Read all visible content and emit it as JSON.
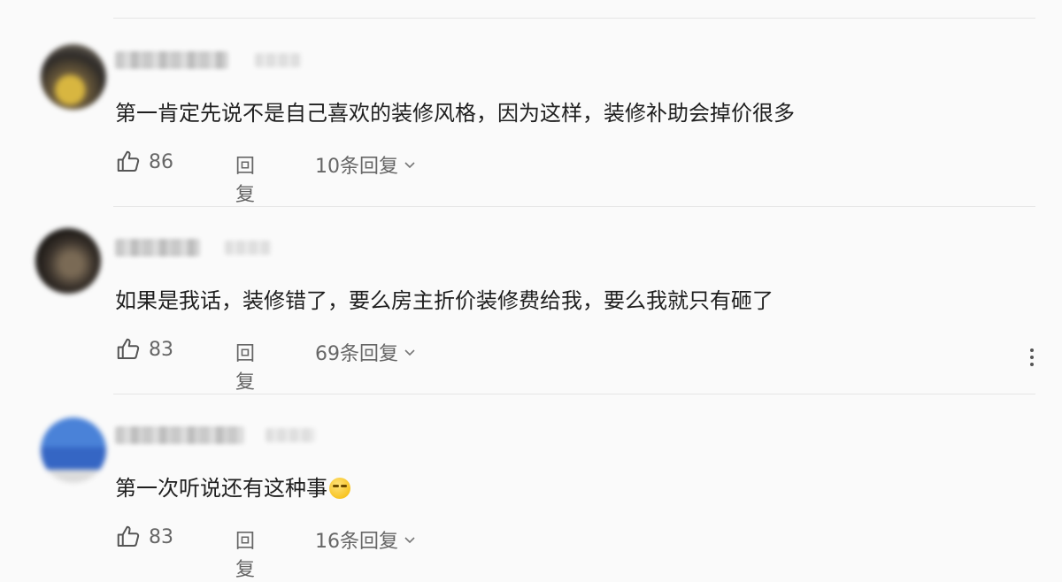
{
  "comments": [
    {
      "text": "第一肯定先说不是自己喜欢的装修风格，因为这样，装修补助会掉价很多",
      "likes": "86",
      "reply_label": "回复",
      "replies_label": "10条回复"
    },
    {
      "text": "如果是我话，装修错了，要么房主折价装修费给我，要么我就只有砸了",
      "likes": "83",
      "reply_label": "回复",
      "replies_label": "69条回复"
    },
    {
      "text": "第一次听说还有这种事",
      "emoji": "smirk-emoji",
      "likes": "83",
      "reply_label": "回复",
      "replies_label": "16条回复"
    }
  ],
  "icons": {
    "like": "thumbs-up-icon",
    "expand": "chevron-down-icon",
    "more": "more-vertical-icon"
  },
  "colors": {
    "background": "#fafafa",
    "text": "#1f1f1f",
    "secondary": "#666666"
  }
}
